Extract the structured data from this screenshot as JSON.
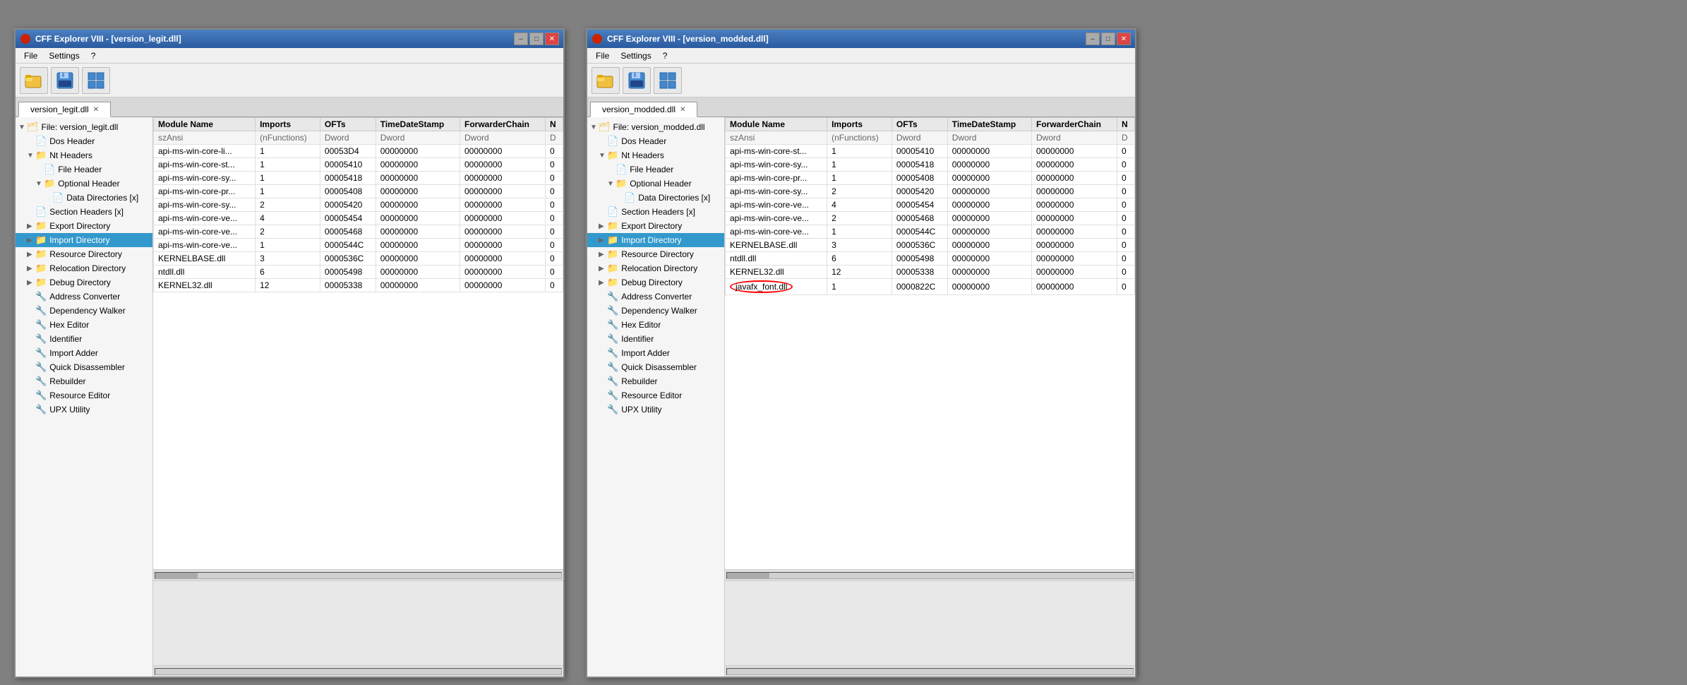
{
  "windows": [
    {
      "id": "left",
      "title": "CFF Explorer VIII - [version_legit.dll]",
      "tab_label": "version_legit.dll",
      "menu": [
        "File",
        "Settings",
        "?"
      ],
      "toolbar_buttons": [
        "open-icon",
        "save-icon",
        "windows-icon"
      ],
      "sidebar": {
        "items": [
          {
            "label": "File: version_legit.dll",
            "level": 0,
            "type": "root",
            "icon": "file",
            "expanded": true
          },
          {
            "label": "Dos Header",
            "level": 1,
            "type": "item",
            "icon": "doc"
          },
          {
            "label": "Nt Headers",
            "level": 1,
            "type": "folder",
            "icon": "doc",
            "expanded": true
          },
          {
            "label": "File Header",
            "level": 2,
            "type": "item",
            "icon": "doc"
          },
          {
            "label": "Optional Header",
            "level": 2,
            "type": "folder",
            "icon": "doc",
            "expanded": true
          },
          {
            "label": "Data Directories [x]",
            "level": 3,
            "type": "item",
            "icon": "doc"
          },
          {
            "label": "Section Headers [x]",
            "level": 1,
            "type": "item",
            "icon": "doc"
          },
          {
            "label": "Export Directory",
            "level": 1,
            "type": "folder",
            "icon": "folder"
          },
          {
            "label": "Import Directory",
            "level": 1,
            "type": "folder",
            "icon": "folder",
            "selected": true
          },
          {
            "label": "Resource Directory",
            "level": 1,
            "type": "folder",
            "icon": "folder"
          },
          {
            "label": "Relocation Directory",
            "level": 1,
            "type": "folder",
            "icon": "folder"
          },
          {
            "label": "Debug Directory",
            "level": 1,
            "type": "folder",
            "icon": "folder"
          },
          {
            "label": "Address Converter",
            "level": 1,
            "type": "tool",
            "icon": "tool"
          },
          {
            "label": "Dependency Walker",
            "level": 1,
            "type": "tool",
            "icon": "tool"
          },
          {
            "label": "Hex Editor",
            "level": 1,
            "type": "tool",
            "icon": "tool"
          },
          {
            "label": "Identifier",
            "level": 1,
            "type": "tool",
            "icon": "tool"
          },
          {
            "label": "Import Adder",
            "level": 1,
            "type": "tool",
            "icon": "tool"
          },
          {
            "label": "Quick Disassembler",
            "level": 1,
            "type": "tool",
            "icon": "tool"
          },
          {
            "label": "Rebuilder",
            "level": 1,
            "type": "tool",
            "icon": "tool"
          },
          {
            "label": "Resource Editor",
            "level": 1,
            "type": "tool",
            "icon": "tool"
          },
          {
            "label": "UPX Utility",
            "level": 1,
            "type": "tool",
            "icon": "tool"
          }
        ]
      },
      "table": {
        "columns": [
          "Module Name",
          "Imports",
          "OFTs",
          "TimeDateStamp",
          "ForwarderChain",
          "N"
        ],
        "subheader": [
          "szAnsi",
          "(nFunctions)",
          "Dword",
          "Dword",
          "Dword",
          "D"
        ],
        "rows": [
          [
            "api-ms-win-core-li...",
            "1",
            "00053D4",
            "00000000",
            "00000000",
            "0"
          ],
          [
            "api-ms-win-core-st...",
            "1",
            "00005410",
            "00000000",
            "00000000",
            "0"
          ],
          [
            "api-ms-win-core-sy...",
            "1",
            "00005418",
            "00000000",
            "00000000",
            "0"
          ],
          [
            "api-ms-win-core-pr...",
            "1",
            "00005408",
            "00000000",
            "00000000",
            "0"
          ],
          [
            "api-ms-win-core-sy...",
            "2",
            "00005420",
            "00000000",
            "00000000",
            "0"
          ],
          [
            "api-ms-win-core-ve...",
            "4",
            "00005454",
            "00000000",
            "00000000",
            "0"
          ],
          [
            "api-ms-win-core-ve...",
            "2",
            "00005468",
            "00000000",
            "00000000",
            "0"
          ],
          [
            "api-ms-win-core-ve...",
            "1",
            "0000544C",
            "00000000",
            "00000000",
            "0"
          ],
          [
            "KERNELBASE.dll",
            "3",
            "0000536C",
            "00000000",
            "00000000",
            "0"
          ],
          [
            "ntdll.dll",
            "6",
            "00005498",
            "00000000",
            "00000000",
            "0"
          ],
          [
            "KERNEL32.dll",
            "12",
            "00005338",
            "00000000",
            "00000000",
            "0"
          ]
        ]
      }
    },
    {
      "id": "right",
      "title": "CFF Explorer VIII - [version_modded.dll]",
      "tab_label": "version_modded.dll",
      "menu": [
        "File",
        "Settings",
        "?"
      ],
      "toolbar_buttons": [
        "open-icon",
        "save-icon",
        "windows-icon"
      ],
      "sidebar": {
        "items": [
          {
            "label": "File: version_modded.dll",
            "level": 0,
            "type": "root",
            "icon": "file",
            "expanded": true
          },
          {
            "label": "Dos Header",
            "level": 1,
            "type": "item",
            "icon": "doc"
          },
          {
            "label": "Nt Headers",
            "level": 1,
            "type": "folder",
            "icon": "doc",
            "expanded": true
          },
          {
            "label": "File Header",
            "level": 2,
            "type": "item",
            "icon": "doc"
          },
          {
            "label": "Optional Header",
            "level": 2,
            "type": "folder",
            "icon": "doc",
            "expanded": true
          },
          {
            "label": "Data Directories [x]",
            "level": 3,
            "type": "item",
            "icon": "doc"
          },
          {
            "label": "Section Headers [x]",
            "level": 1,
            "type": "item",
            "icon": "doc"
          },
          {
            "label": "Export Directory",
            "level": 1,
            "type": "folder",
            "icon": "folder"
          },
          {
            "label": "Import Directory",
            "level": 1,
            "type": "folder",
            "icon": "folder",
            "selected": true
          },
          {
            "label": "Resource Directory",
            "level": 1,
            "type": "folder",
            "icon": "folder"
          },
          {
            "label": "Relocation Directory",
            "level": 1,
            "type": "folder",
            "icon": "folder"
          },
          {
            "label": "Debug Directory",
            "level": 1,
            "type": "folder",
            "icon": "folder"
          },
          {
            "label": "Address Converter",
            "level": 1,
            "type": "tool",
            "icon": "tool"
          },
          {
            "label": "Dependency Walker",
            "level": 1,
            "type": "tool",
            "icon": "tool"
          },
          {
            "label": "Hex Editor",
            "level": 1,
            "type": "tool",
            "icon": "tool"
          },
          {
            "label": "Identifier",
            "level": 1,
            "type": "tool",
            "icon": "tool"
          },
          {
            "label": "Import Adder",
            "level": 1,
            "type": "tool",
            "icon": "tool"
          },
          {
            "label": "Quick Disassembler",
            "level": 1,
            "type": "tool",
            "icon": "tool"
          },
          {
            "label": "Rebuilder",
            "level": 1,
            "type": "tool",
            "icon": "tool"
          },
          {
            "label": "Resource Editor",
            "level": 1,
            "type": "tool",
            "icon": "tool"
          },
          {
            "label": "UPX Utility",
            "level": 1,
            "type": "tool",
            "icon": "tool"
          }
        ]
      },
      "table": {
        "columns": [
          "Module Name",
          "Imports",
          "OFTs",
          "TimeDateStamp",
          "ForwarderChain",
          "N"
        ],
        "subheader": [
          "szAnsi",
          "(nFunctions)",
          "Dword",
          "Dword",
          "Dword",
          "D"
        ],
        "rows": [
          [
            "api-ms-win-core-st...",
            "1",
            "00005410",
            "00000000",
            "00000000",
            "0"
          ],
          [
            "api-ms-win-core-sy...",
            "1",
            "00005418",
            "00000000",
            "00000000",
            "0"
          ],
          [
            "api-ms-win-core-pr...",
            "1",
            "00005408",
            "00000000",
            "00000000",
            "0"
          ],
          [
            "api-ms-win-core-sy...",
            "2",
            "00005420",
            "00000000",
            "00000000",
            "0"
          ],
          [
            "api-ms-win-core-ve...",
            "4",
            "00005454",
            "00000000",
            "00000000",
            "0"
          ],
          [
            "api-ms-win-core-ve...",
            "2",
            "00005468",
            "00000000",
            "00000000",
            "0"
          ],
          [
            "api-ms-win-core-ve...",
            "1",
            "0000544C",
            "00000000",
            "00000000",
            "0"
          ],
          [
            "KERNELBASE.dll",
            "3",
            "0000536C",
            "00000000",
            "00000000",
            "0"
          ],
          [
            "ntdll.dll",
            "6",
            "00005498",
            "00000000",
            "00000000",
            "0"
          ],
          [
            "KERNEL32.dll",
            "12",
            "00005338",
            "00000000",
            "00000000",
            "0"
          ],
          [
            "javafx_font.dll",
            "1",
            "0000822C",
            "00000000",
            "00000000",
            "0"
          ]
        ],
        "highlighted_row": 10
      }
    }
  ]
}
